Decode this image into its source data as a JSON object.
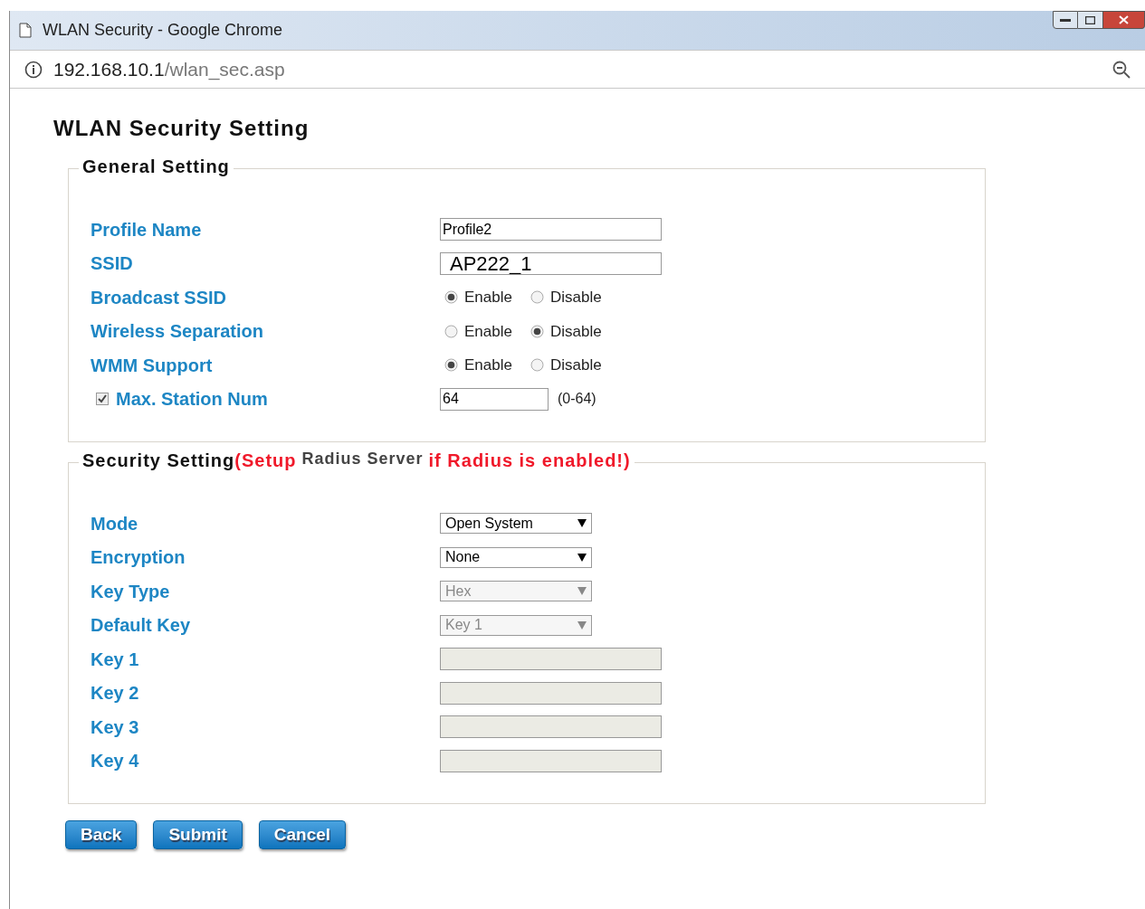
{
  "window": {
    "title": "WLAN Security - Google Chrome"
  },
  "address_bar": {
    "host": "192.168.10.1",
    "path": "/wlan_sec.asp"
  },
  "page_title": "WLAN Security Setting",
  "general": {
    "legend": [
      {
        "text": "General Setting",
        "kind": "plain"
      }
    ],
    "rows": [
      {
        "kind": "text",
        "label": "Profile Name",
        "value": "Profile2"
      },
      {
        "kind": "text",
        "label": "SSID",
        "value": "AP222_1",
        "large": true
      },
      {
        "kind": "radio",
        "label": "Broadcast SSID",
        "options": [
          {
            "label": "Enable",
            "selected": true
          },
          {
            "label": "Disable",
            "selected": false
          }
        ]
      },
      {
        "kind": "radio",
        "label": "Wireless Separation",
        "options": [
          {
            "label": "Enable",
            "selected": false
          },
          {
            "label": "Disable",
            "selected": true
          }
        ]
      },
      {
        "kind": "radio",
        "label": "WMM Support",
        "options": [
          {
            "label": "Enable",
            "selected": true
          },
          {
            "label": "Disable",
            "selected": false
          }
        ]
      },
      {
        "kind": "checknum",
        "label": "Max. Station Num",
        "checked": true,
        "value": "64",
        "hint": "(0-64)"
      }
    ]
  },
  "security": {
    "legend": [
      {
        "text": "Security Setting",
        "kind": "plain"
      },
      {
        "text": "(Setup",
        "kind": "warning"
      },
      {
        "text": "Radius Server",
        "kind": "note"
      },
      {
        "text": "if Radius is enabled!)",
        "kind": "warning"
      }
    ],
    "rows": [
      {
        "kind": "select",
        "label": "Mode",
        "value": "Open System",
        "disabled": false
      },
      {
        "kind": "select",
        "label": "Encryption",
        "value": "None",
        "disabled": false
      },
      {
        "kind": "select",
        "label": "Key Type",
        "value": "Hex",
        "disabled": true
      },
      {
        "kind": "select",
        "label": "Default Key",
        "value": "Key 1",
        "disabled": true
      },
      {
        "kind": "text",
        "label": "Key 1",
        "disabled": true
      },
      {
        "kind": "text",
        "label": "Key 2",
        "disabled": true
      },
      {
        "kind": "text",
        "label": "Key 3",
        "disabled": true
      },
      {
        "kind": "text",
        "label": "Key 4",
        "disabled": true
      }
    ]
  },
  "buttons": [
    "Back",
    "Submit",
    "Cancel"
  ]
}
